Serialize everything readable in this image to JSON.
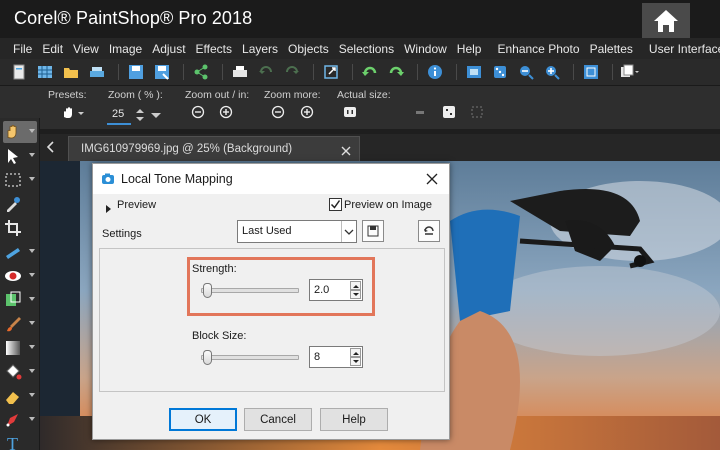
{
  "app": {
    "title": "Corel® PaintShop® Pro 2018"
  },
  "menubar": {
    "items": [
      "File",
      "Edit",
      "View",
      "Image",
      "Adjust",
      "Effects",
      "Layers",
      "Objects",
      "Selections",
      "Window",
      "Help",
      "Enhance Photo",
      "Palettes",
      "User Interface"
    ]
  },
  "toolbar": {
    "icons": [
      "new-file-icon",
      "grid-icon",
      "open-folder-icon",
      "scan-icon",
      "save-icon",
      "save-as-icon",
      "share-icon",
      "print-icon",
      "undo-icon",
      "redo-icon",
      "resize-icon",
      "undo-history-icon",
      "redo-history-icon",
      "info-icon",
      "crop-icon",
      "dice-icon",
      "zoom-out-icon",
      "zoom-in-icon",
      "fit-icon",
      "layers-icon"
    ]
  },
  "options": {
    "presets_label": "Presets:",
    "zoom_label": "Zoom ( % ):",
    "zoom_value": "25",
    "zoom_out_in_label": "Zoom out / in:",
    "zoom_more_label": "Zoom more:",
    "actual_size_label": "Actual size:"
  },
  "document": {
    "tab_label": "IMG610979969.jpg @  25% (Background)"
  },
  "dialog": {
    "title": "Local Tone Mapping",
    "preview_label": "Preview",
    "preview_on_image_label": "Preview on Image",
    "preview_on_image_checked": true,
    "settings_label": "Settings",
    "preset_value": "Last Used",
    "strength_label": "Strength:",
    "strength_value": "2.0",
    "strength_fraction": 0.02,
    "block_size_label": "Block Size:",
    "block_size_value": "8",
    "block_size_fraction": 0.02,
    "ok_label": "OK",
    "cancel_label": "Cancel",
    "help_label": "Help"
  },
  "colors": {
    "highlight": "#e2765a",
    "accent": "#0078d7",
    "app_bg": "#1e1e1e"
  }
}
